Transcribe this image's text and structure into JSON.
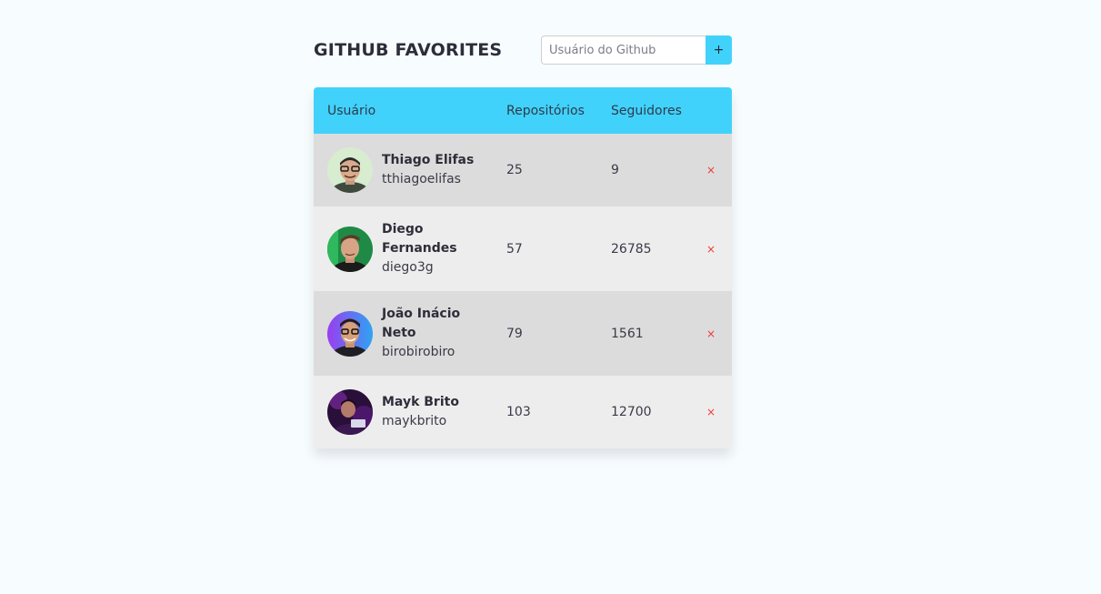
{
  "header": {
    "title": "GITHUB FAVORITES",
    "search_placeholder": "Usuário do Github",
    "add_label": "+"
  },
  "table": {
    "columns": [
      "Usuário",
      "Repositórios",
      "Seguidores"
    ],
    "remove_label": "×",
    "rows": [
      {
        "name": "Thiago Elifas",
        "login": "tthiagoelifas",
        "repos": "25",
        "followers": "9"
      },
      {
        "name": "Diego Fernandes",
        "login": "diego3g",
        "repos": "57",
        "followers": "26785"
      },
      {
        "name": "João Inácio Neto",
        "login": "birobirobiro",
        "repos": "79",
        "followers": "1561"
      },
      {
        "name": "Mayk Brito",
        "login": "maykbrito",
        "repos": "103",
        "followers": "12700"
      }
    ]
  },
  "colors": {
    "accent": "#41d2fb",
    "remove": "#f03a3a",
    "row_odd": "#dcdcdc",
    "row_even": "#eeeded",
    "background": "#f7fcff"
  }
}
